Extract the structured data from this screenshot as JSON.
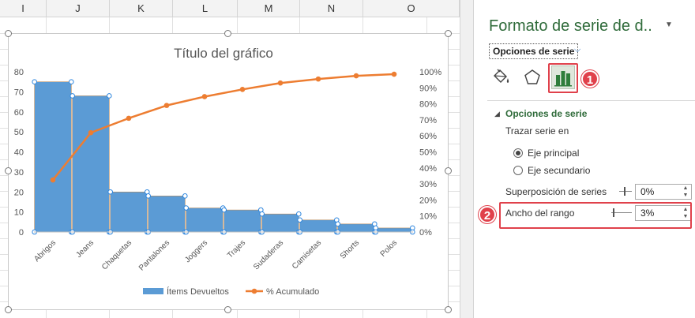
{
  "sheet": {
    "columns": [
      "I",
      "J",
      "K",
      "L",
      "M",
      "N",
      "O"
    ]
  },
  "chart_data": {
    "type": "bar",
    "title": "Título del gráfico",
    "categories": [
      "Abrigos",
      "Jeans",
      "Chaquetas",
      "Pantalones",
      "Joggers",
      "Trajes",
      "Sudaderas",
      "Camisetas",
      "Shorts",
      "Polos"
    ],
    "series": [
      {
        "name": "Ítems Devueltos",
        "type": "bar",
        "axis": "primary",
        "color": "#5b9bd5",
        "values": [
          75,
          68,
          20,
          18,
          12,
          11,
          9,
          6,
          4,
          2
        ]
      },
      {
        "name": "% Acumulado",
        "type": "line",
        "axis": "secondary",
        "color": "#ed7d31",
        "values": [
          32.5,
          62,
          71,
          79,
          84.5,
          89,
          93,
          95.5,
          97.5,
          98.5
        ]
      }
    ],
    "y_axis": {
      "min": 0,
      "max": 80,
      "step": 10,
      "ticks": [
        "0",
        "10",
        "20",
        "30",
        "40",
        "50",
        "60",
        "70",
        "80"
      ]
    },
    "y2_axis": {
      "min": 0,
      "max": 100,
      "step": 10,
      "ticks": [
        "0%",
        "10%",
        "20%",
        "30%",
        "40%",
        "50%",
        "60%",
        "70%",
        "80%",
        "90%",
        "100%"
      ]
    },
    "grid": false,
    "legend_position": "bottom"
  },
  "panel": {
    "title": "Formato de serie de d..",
    "options_dropdown": "Opciones de serie",
    "badge_1": "1",
    "badge_2": "2",
    "section_title": "Opciones de serie",
    "plot_on_label": "Trazar serie en",
    "radio_primary": "Eje principal",
    "radio_secondary": "Eje secundario",
    "overlap_label": "Superposición de series",
    "overlap_value": "0%",
    "gap_label": "Ancho del rango",
    "gap_value": "3%"
  }
}
